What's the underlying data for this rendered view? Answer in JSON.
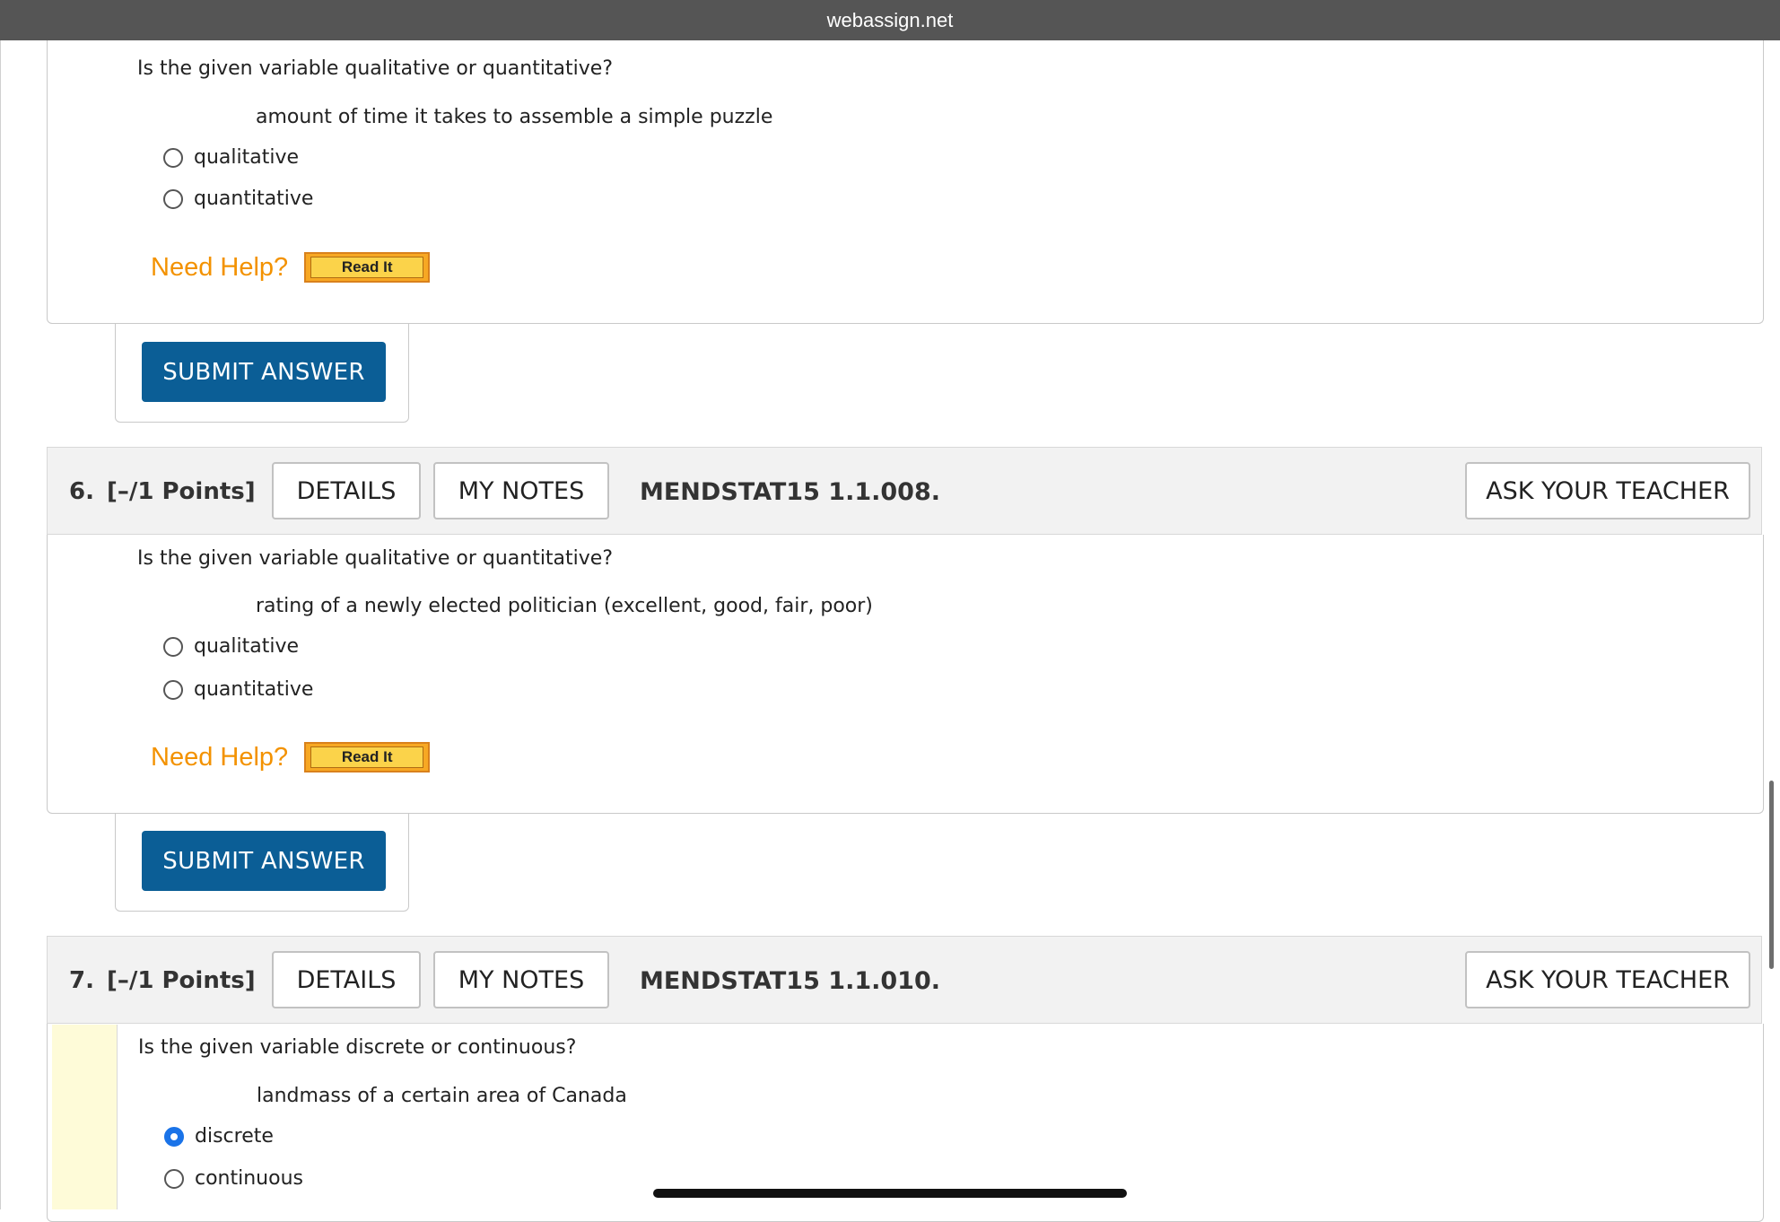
{
  "browser": {
    "url": "webassign.net"
  },
  "q5": {
    "prompt": "Is the given variable qualitative or quantitative?",
    "variable": "amount of time it takes to assemble a simple puzzle",
    "options": [
      {
        "label": "qualitative",
        "selected": false
      },
      {
        "label": "quantitative",
        "selected": false
      }
    ],
    "need_help": "Need Help?",
    "read_it": "Read It",
    "submit": "SUBMIT ANSWER"
  },
  "q6": {
    "number": "6.",
    "points": "[–/1 Points]",
    "details": "DETAILS",
    "my_notes": "MY NOTES",
    "code": "MENDSTAT15 1.1.008.",
    "ask_teacher": "ASK YOUR TEACHER",
    "prompt": "Is the given variable qualitative or quantitative?",
    "variable": "rating of a newly elected politician (excellent, good, fair, poor)",
    "options": [
      {
        "label": "qualitative",
        "selected": false
      },
      {
        "label": "quantitative",
        "selected": false
      }
    ],
    "need_help": "Need Help?",
    "read_it": "Read It",
    "submit": "SUBMIT ANSWER"
  },
  "q7": {
    "number": "7.",
    "points": "[–/1 Points]",
    "details": "DETAILS",
    "my_notes": "MY NOTES",
    "code": "MENDSTAT15 1.1.010.",
    "ask_teacher": "ASK YOUR TEACHER",
    "prompt": "Is the given variable discrete or continuous?",
    "variable": "landmass of a certain area of Canada",
    "options": [
      {
        "label": "discrete",
        "selected": true
      },
      {
        "label": "continuous",
        "selected": false
      }
    ]
  },
  "colors": {
    "need_help": "#f39200",
    "submit_bg": "#0b5e96",
    "radio_selected": "#1a73e8",
    "topbar": "#555555"
  }
}
